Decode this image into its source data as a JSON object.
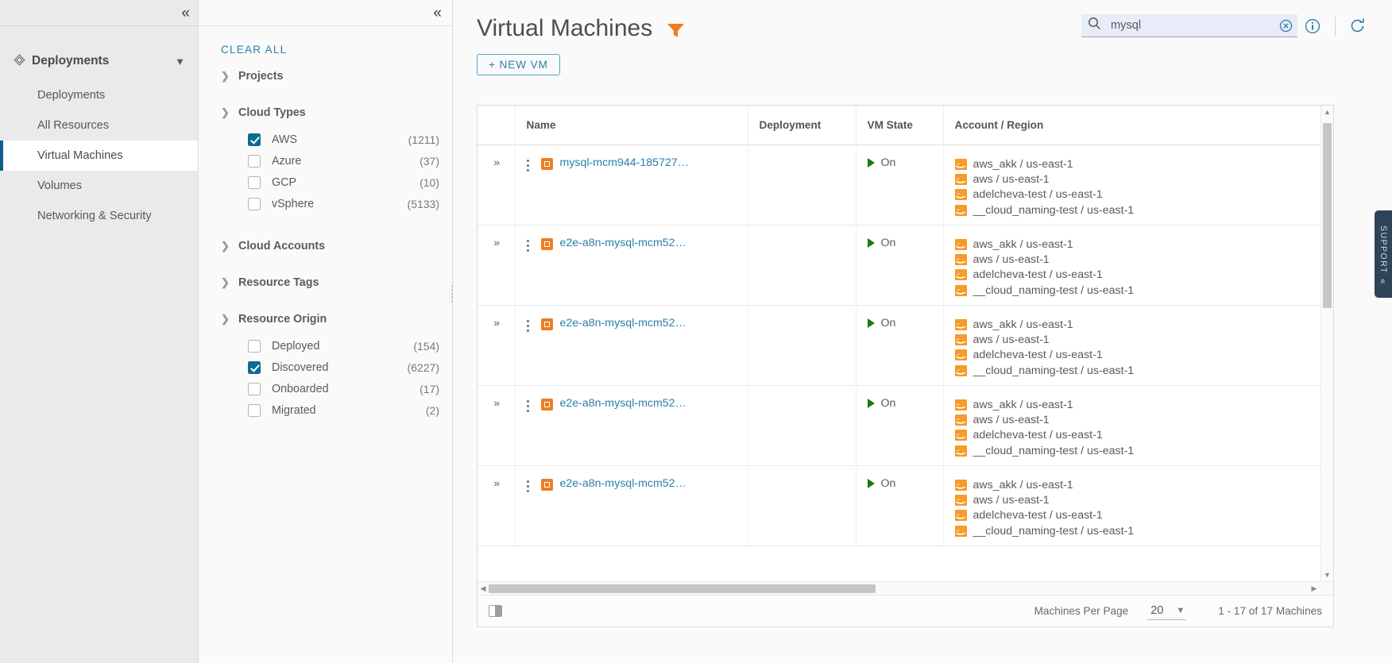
{
  "nav": {
    "collapse_icon": "double-chevron-left",
    "group": {
      "label": "Deployments",
      "icon": "deployments-icon",
      "chevron": "chevron-down"
    },
    "items": [
      {
        "label": "Deployments",
        "active": false
      },
      {
        "label": "All Resources",
        "active": false
      },
      {
        "label": "Virtual Machines",
        "active": true
      },
      {
        "label": "Volumes",
        "active": false
      },
      {
        "label": "Networking & Security",
        "active": false
      }
    ]
  },
  "filters": {
    "collapse_icon": "double-chevron-left",
    "clear_all": "CLEAR ALL",
    "groups": [
      {
        "label": "Projects",
        "expanded": false,
        "options": []
      },
      {
        "label": "Cloud Types",
        "expanded": true,
        "options": [
          {
            "label": "AWS",
            "count": "(1211)",
            "checked": true
          },
          {
            "label": "Azure",
            "count": "(37)",
            "checked": false
          },
          {
            "label": "GCP",
            "count": "(10)",
            "checked": false
          },
          {
            "label": "vSphere",
            "count": "(5133)",
            "checked": false
          }
        ]
      },
      {
        "label": "Cloud Accounts",
        "expanded": false,
        "options": []
      },
      {
        "label": "Resource Tags",
        "expanded": false,
        "options": []
      },
      {
        "label": "Resource Origin",
        "expanded": true,
        "options": [
          {
            "label": "Deployed",
            "count": "(154)",
            "checked": false
          },
          {
            "label": "Discovered",
            "count": "(6227)",
            "checked": true
          },
          {
            "label": "Onboarded",
            "count": "(17)",
            "checked": false
          },
          {
            "label": "Migrated",
            "count": "(2)",
            "checked": false
          }
        ]
      }
    ]
  },
  "header": {
    "title": "Virtual Machines",
    "filter_icon": "funnel-icon",
    "new_vm_label": "+ NEW VM",
    "search": {
      "value": "mysql",
      "placeholder": "Search",
      "icon": "search-icon",
      "clear_icon": "clear-circle-icon",
      "info_icon": "info-circle-icon"
    },
    "refresh_icon": "refresh-icon"
  },
  "table": {
    "columns": [
      "",
      "Name",
      "Deployment",
      "VM State",
      "Account / Region"
    ],
    "rows": [
      {
        "name": "mysql-mcm944-185727…",
        "deployment": "",
        "state": "On",
        "accounts": [
          "aws_akk / us-east-1",
          "aws / us-east-1",
          "adelcheva-test / us-east-1",
          "__cloud_naming-test / us-east-1"
        ]
      },
      {
        "name": "e2e-a8n-mysql-mcm52…",
        "deployment": "",
        "state": "On",
        "accounts": [
          "aws_akk / us-east-1",
          "aws / us-east-1",
          "adelcheva-test / us-east-1",
          "__cloud_naming-test / us-east-1"
        ]
      },
      {
        "name": "e2e-a8n-mysql-mcm52…",
        "deployment": "",
        "state": "On",
        "accounts": [
          "aws_akk / us-east-1",
          "aws / us-east-1",
          "adelcheva-test / us-east-1",
          "__cloud_naming-test / us-east-1"
        ]
      },
      {
        "name": "e2e-a8n-mysql-mcm52…",
        "deployment": "",
        "state": "On",
        "accounts": [
          "aws_akk / us-east-1",
          "aws / us-east-1",
          "adelcheva-test / us-east-1",
          "__cloud_naming-test / us-east-1"
        ]
      },
      {
        "name": "e2e-a8n-mysql-mcm52…",
        "deployment": "",
        "state": "On",
        "accounts": [
          "aws_akk / us-east-1",
          "aws / us-east-1",
          "adelcheva-test / us-east-1",
          "__cloud_naming-test / us-east-1"
        ]
      }
    ]
  },
  "footer": {
    "column_toggle_icon": "column-toggle-icon",
    "per_page_label": "Machines Per Page",
    "per_page_value": "20",
    "per_page_chevron": "chevron-down-icon",
    "range": "1 - 17 of 17 Machines"
  },
  "support": {
    "label": "SUPPORT",
    "chevron": "double-chevron-left"
  },
  "colors": {
    "accent": "#2a7fad",
    "active_bar": "#0d5e8a",
    "checkbox_on": "#0f6a94",
    "aws_orange": "#f59b2a",
    "vm_orange": "#ee7d21",
    "state_green": "#1a7a1a",
    "support_navy": "#2f4458",
    "search_bg": "#e7ecf8"
  }
}
